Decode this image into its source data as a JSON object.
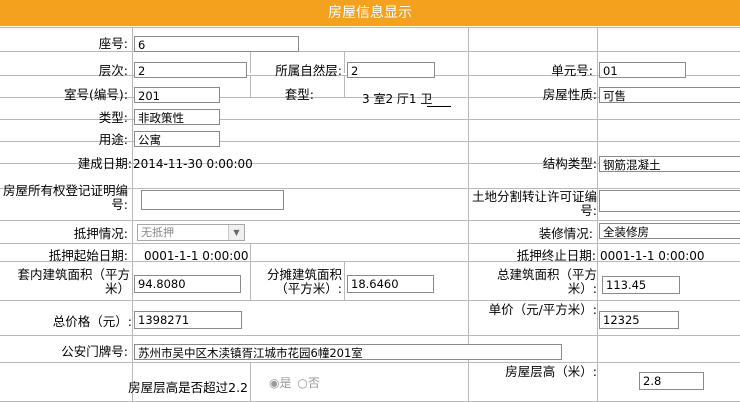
{
  "header": {
    "title": "房屋信息显示"
  },
  "fields": {
    "seat_no": {
      "label": "座号:",
      "value": "6"
    },
    "floor": {
      "label": "层次:",
      "value": "2"
    },
    "natural_floor": {
      "label": "所属自然层:",
      "value": "2"
    },
    "unit_no": {
      "label": "单元号:",
      "value": "01"
    },
    "room_no": {
      "label": "室号(编号):",
      "value": "201"
    },
    "layout": {
      "label": "套型:",
      "value": "3 室2 厅1 卫"
    },
    "property_nature": {
      "label": "房屋性质:",
      "value": "可售"
    },
    "type": {
      "label": "类型:",
      "value": "非政策性"
    },
    "usage": {
      "label": "用途:",
      "value": "公寓"
    },
    "build_date": {
      "label": "建成日期:",
      "value": "2014-11-30 0:00:00"
    },
    "structure_type": {
      "label": "结构类型:",
      "value": "钢筋混凝土"
    },
    "ownership_cert": {
      "label": "房屋所有权登记证明编号:",
      "value": ""
    },
    "land_permit": {
      "label": "土地分割转让许可证编号:",
      "value": ""
    },
    "mortgage": {
      "label": "抵押情况:",
      "value": "无抵押"
    },
    "decoration": {
      "label": "装修情况:",
      "value": "全装修房"
    },
    "mortgage_start": {
      "label": "抵押起始日期:",
      "value": "0001-1-1 0:00:00"
    },
    "mortgage_end": {
      "label": "抵押终止日期:",
      "value": "0001-1-1 0:00:00"
    },
    "inner_area": {
      "label": "套内建筑面积（平方米）",
      "value": "94.8080"
    },
    "shared_area": {
      "label": "分摊建筑面积（平方米）:",
      "value": "18.6460"
    },
    "total_area": {
      "label": "总建筑面积（平方米）:",
      "value": "113.45"
    },
    "total_price": {
      "label": "总价格（元）:",
      "value": "1398271"
    },
    "unit_price": {
      "label": "单价（元/平方米）:",
      "value": "12325"
    },
    "address": {
      "label": "公安门牌号:",
      "value": "苏州市吴中区木渎镇胥江城市花园6幢201室"
    },
    "height_exceed": {
      "label": "房屋层高是否超过2.2",
      "yes": "是",
      "no": "否"
    },
    "floor_height": {
      "label": "房屋层高（米）:",
      "value": "2.8"
    }
  }
}
